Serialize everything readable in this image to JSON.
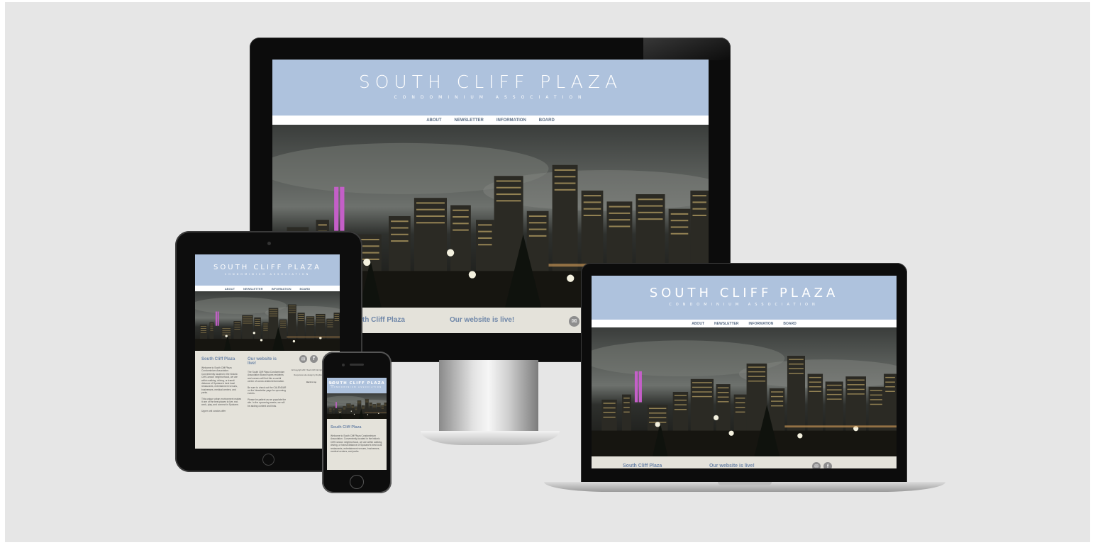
{
  "site": {
    "title": "SOUTH CLIFF PLAZA",
    "subtitle": "CONDOMINIUM ASSOCIATION",
    "nav": [
      "ABOUT",
      "NEWSLETTER",
      "INFORMATION",
      "BOARD"
    ],
    "col1_heading": "South Cliff Plaza",
    "col2_heading": "Our website is live!",
    "col1_body_1": "Welcome to South Cliff Plaza Condominium Association. Conveniently located in the historic Cliff Cannon neighborhood, we are within walking, driving, or transit distance of Spokane's best local restaurants, entertainment venues, businesses, medical centers, and parks.",
    "col1_body_2": "This unique urban environment makes it one of the best places to live, eat, work, play, and connect in Spokane.",
    "col1_body_3": "Upper unit condos offer",
    "col2_body_1": "The South Cliff Plaza Condominium Association Board hopes residents and owners will find this a useful center of condo-related information.",
    "col2_body_2": "Be sure to check out the CALENDAR on the Newsletter page for upcoming events.",
    "col2_body_3": "Please be patient as we populate the site. In the upcoming weeks, we will be adding content and links.",
    "copyright": "All Copyright 2017 South Cliff. All rights reserved.",
    "responsive": "Responsive site design by RoyDesign.com",
    "back_to_top": "Back to top",
    "phone_body": "Welcome to South Cliff Plaza Condominium Association. Conveniently located in the historic Cliff Cannon neighborhood, we are within walking, driving, or transit distance of Spokane's best local restaurants, entertainment venues, businesses, medical centers, and parks."
  },
  "colors": {
    "header": "#aec2dd",
    "heading": "#6e86a8",
    "content_bg": "#e4e2da",
    "stage": "#e6e6e6"
  },
  "icons": [
    "envelope-icon",
    "facebook-icon",
    "hamburger-icon",
    "home-button-icon"
  ]
}
